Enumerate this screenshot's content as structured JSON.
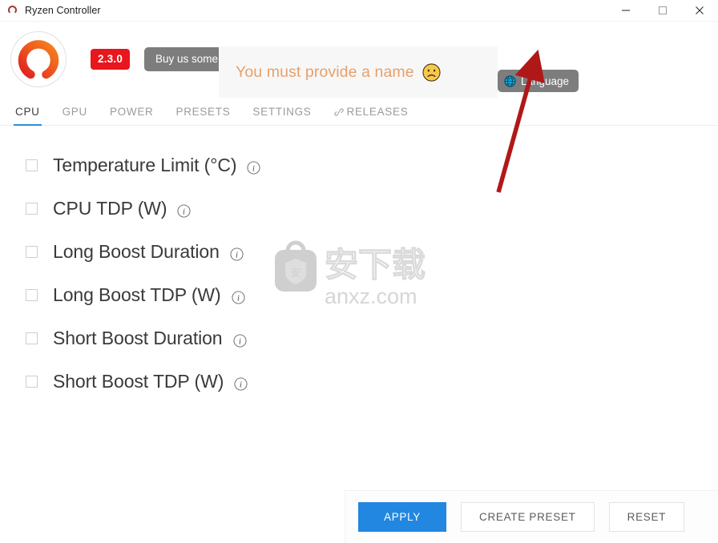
{
  "window": {
    "title": "Ryzen Controller",
    "app_icon": "ryzen-logo-icon",
    "controls": {
      "minimize": "minimize-icon",
      "maximize": "maximize-icon",
      "close": "close-icon"
    }
  },
  "header": {
    "logo_icon": "ryzen-controller-logo",
    "version": "2.3.0",
    "donate_label": "Buy us some b",
    "language_label": "Language",
    "language_icon": "globe-icon"
  },
  "toast": {
    "message": "You must provide a name",
    "emoji": "frowning-face-emoji",
    "background": "#f7f7f7",
    "text_color": "#e8a06a"
  },
  "tabs": [
    {
      "label": "CPU",
      "active": true,
      "icon": null
    },
    {
      "label": "GPU",
      "active": false,
      "icon": null
    },
    {
      "label": "POWER",
      "active": false,
      "icon": null
    },
    {
      "label": "PRESETS",
      "active": false,
      "icon": null
    },
    {
      "label": "SETTINGS",
      "active": false,
      "icon": null
    },
    {
      "label": "RELEASES",
      "active": false,
      "icon": "link-icon"
    }
  ],
  "settings": [
    {
      "label": "Temperature Limit (°C)",
      "checked": false
    },
    {
      "label": "CPU TDP (W)",
      "checked": false
    },
    {
      "label": "Long Boost Duration",
      "checked": false
    },
    {
      "label": "Long Boost TDP (W)",
      "checked": false
    },
    {
      "label": "Short Boost Duration",
      "checked": false
    },
    {
      "label": "Short Boost TDP (W)",
      "checked": false
    }
  ],
  "actions": {
    "apply_label": "APPLY",
    "create_preset_label": "CREATE PRESET",
    "reset_label": "RESET",
    "accent": "#2287e0"
  },
  "watermark": {
    "site": "anxz.com",
    "chinese": "安下载",
    "shield_char": "安"
  },
  "annotation": {
    "arrow_color": "#b01818",
    "points_to": "Language"
  }
}
